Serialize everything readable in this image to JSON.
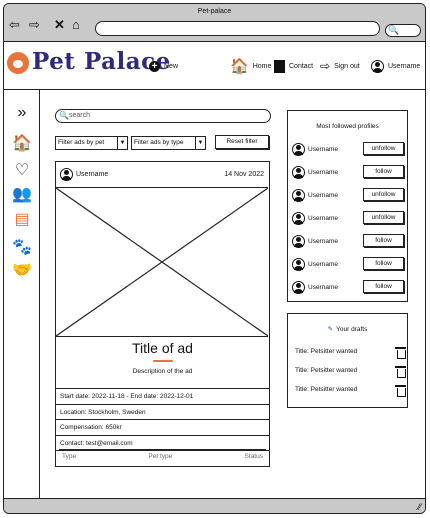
{
  "browser": {
    "title": "Pet-palace",
    "back_icon": "back-arrow-icon",
    "forward_icon": "forward-arrow-icon",
    "close_icon": "close-icon",
    "home_icon": "home-icon"
  },
  "header": {
    "logo": "Pet Palace",
    "new_label": "New",
    "home_label": "Home",
    "contact_label": "Contact",
    "signout_label": "Sign out",
    "username_label": "Username"
  },
  "sidebar": {
    "items": [
      {
        "name": "expand-icon",
        "glyph": "»"
      },
      {
        "name": "home-icon",
        "glyph": "🏠"
      },
      {
        "name": "heart-icon",
        "glyph": "♡"
      },
      {
        "name": "group-icon",
        "glyph": "👥"
      },
      {
        "name": "id-card-icon",
        "glyph": "▤"
      },
      {
        "name": "paw-icon",
        "glyph": "🐾"
      },
      {
        "name": "handshake-icon",
        "glyph": "🤝"
      }
    ]
  },
  "search": {
    "placeholder": "search"
  },
  "filters": {
    "by_pet": "Filter ads by pet",
    "by_type": "Filter ads by type",
    "reset": "Reset filter"
  },
  "ad": {
    "username": "Username",
    "date": "14 Nov 2022",
    "title": "Title of ad",
    "description": "Description of the ad",
    "dates": "Start date: 2022-11-18 - End date: 2022-12-01",
    "location": "Location: Stockholm, Sweden",
    "compensation": "Compensation: 650kr",
    "contact": "Contact: test@email.com",
    "footer": {
      "type": "Type",
      "pet_type": "Pet type",
      "status": "Status"
    }
  },
  "followed": {
    "title": "Most followed profiles",
    "profiles": [
      {
        "username": "Username",
        "action": "unfollow"
      },
      {
        "username": "Username",
        "action": "follow"
      },
      {
        "username": "Username",
        "action": "unfollow"
      },
      {
        "username": "Username",
        "action": "unfollow"
      },
      {
        "username": "Username",
        "action": "follow"
      },
      {
        "username": "Username",
        "action": "follow"
      },
      {
        "username": "Username",
        "action": "follow"
      }
    ]
  },
  "drafts": {
    "title": "Your drafts",
    "items": [
      {
        "title": "Title: Petsitter wanted"
      },
      {
        "title": "Title: Petsitter wanted"
      },
      {
        "title": "Title: Petsitter wanted"
      }
    ]
  },
  "colors": {
    "accent": "#e8733d",
    "logo": "#2f2a7a",
    "chrome": "#c9c9c9"
  }
}
